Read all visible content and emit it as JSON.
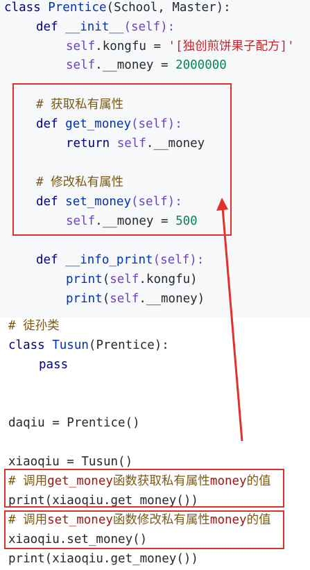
{
  "top_code": {
    "line1": {
      "kw": "class",
      "name": "Prentice",
      "args": "(School, Master):"
    },
    "line2": {
      "kw": "def",
      "name": "__init__",
      "args": "(self):"
    },
    "line3": {
      "self": "self",
      "attr": ".kongfu = ",
      "str": "'[独创煎饼果子配方]'"
    },
    "line4": {
      "self": "self",
      "attr": ".__money = ",
      "num": "2000000"
    },
    "line5": {
      "comment": "# 获取私有属性"
    },
    "line6": {
      "kw": "def",
      "name": "get_money",
      "args": "(self):"
    },
    "line7": {
      "kw": "return",
      "self": "self",
      "attr": ".__money"
    },
    "line8": {
      "comment": "# 修改私有属性"
    },
    "line9": {
      "kw": "def",
      "name": "set_money",
      "args": "(self):"
    },
    "line10": {
      "self": "self",
      "attr": ".__money = ",
      "num": "500"
    },
    "line11": {
      "kw": "def",
      "name": "__info_print",
      "args": "(self):"
    },
    "line12": {
      "fn": "print",
      "open": "(",
      "self": "self",
      "rest": ".kongfu)"
    },
    "line13": {
      "fn": "print",
      "open": "(",
      "self": "self",
      "rest": ".__money)"
    }
  },
  "bottom_code": {
    "line1": {
      "comment": "# 徒孙类"
    },
    "line2": {
      "kw": "class",
      "name": "Tusun",
      "args": "(Prentice):"
    },
    "line3": {
      "kw": "pass"
    },
    "line4": {
      "text": "daqiu = Prentice()"
    },
    "line5": {
      "text": "xiaoqiu = Tusun()"
    },
    "line6": {
      "comment_prefix": "# 调用",
      "hl1": "get_money",
      "mid": "函数获取私有属性",
      "hl2": "money",
      "suffix": "的值"
    },
    "line7": {
      "text": "print(xiaoqiu.get_money())"
    },
    "line8": {
      "comment_prefix": "# 调用",
      "hl1": "set_money",
      "mid": "函数修改私有属性",
      "hl2": "money",
      "suffix": "的值"
    },
    "line9": {
      "text": "xiaoqiu.set_money()"
    },
    "line10": {
      "text": "print(xiaoqiu.get_money())"
    }
  },
  "colors": {
    "annotation_red": "#e0312b",
    "keyword": "#000080",
    "string": "#c1272d",
    "number": "#098658",
    "comment": "#7a5a14"
  }
}
